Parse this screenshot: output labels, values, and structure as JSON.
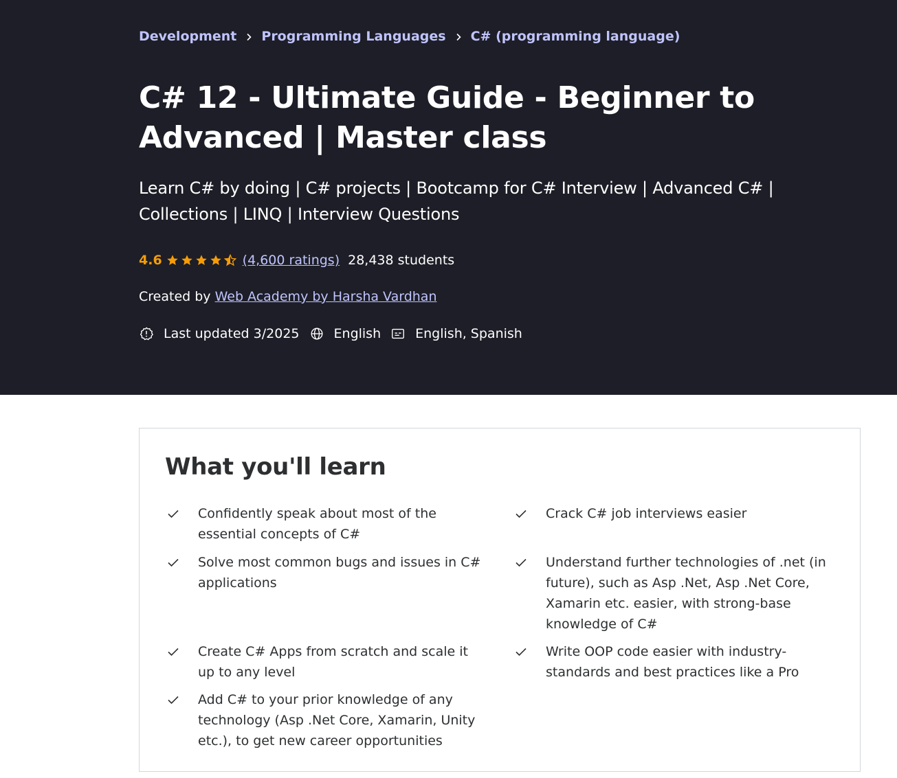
{
  "breadcrumb": [
    "Development",
    "Programming Languages",
    "C# (programming language)"
  ],
  "course": {
    "title": "C# 12 - Ultimate Guide - Beginner to Advanced | Master class",
    "subtitle": "Learn C# by doing | C# projects | Bootcamp for C# Interview | Advanced C# | Collections | LINQ | Interview Questions",
    "rating": "4.6",
    "rating_stars": 4.6,
    "ratings_count": "(4,600 ratings)",
    "students": "28,438 students",
    "created_by_label": "Created by",
    "author": "Web Academy by Harsha Vardhan",
    "last_updated": "Last updated 3/2025",
    "language": "English",
    "captions": "English, Spanish"
  },
  "learn": {
    "heading": "What you'll learn",
    "items": [
      "Confidently speak about most of the essential concepts of C#",
      "Crack C# job interviews easier",
      "Solve most common bugs and issues in C# applications",
      "Understand further technologies of .net (in future), such as Asp .Net, Asp .Net Core, Xamarin etc. easier, with strong-base knowledge of C#",
      "Create C# Apps from scratch and scale it up to any level",
      "Write OOP code easier with industry-standards and best practices like a Pro",
      "Add C# to your prior knowledge of any technology (Asp .Net Core, Xamarin, Unity etc.), to get new career opportunities"
    ]
  },
  "colors": {
    "hero_bg": "#1d1e27",
    "link": "#c0c4fc",
    "rating": "#f69c08"
  }
}
